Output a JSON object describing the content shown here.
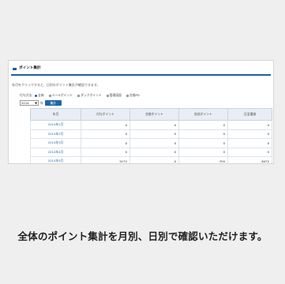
{
  "panel": {
    "title": "ポイント集計",
    "description": "年月をクリックすると、日別のポイント集計が確認できます。",
    "filter": {
      "label": "付与方法：",
      "options": [
        "全体",
        "メールポイント",
        "ダックポイント",
        "管理画面",
        "交換PD"
      ],
      "selected_index": 0
    },
    "year": {
      "value": "2014",
      "arrow": "▼",
      "suffix": "年",
      "button_label": "集計"
    }
  },
  "table": {
    "headers": [
      "年月",
      "付与ポイント",
      "交換ポイント",
      "失効ポイント",
      "日没増減"
    ],
    "rows": [
      {
        "month": "2014年1月",
        "grant": "0",
        "exchange": "0",
        "expire": "0",
        "net": "0"
      },
      {
        "month": "2014年2月",
        "grant": "0",
        "exchange": "0",
        "expire": "0",
        "net": "0"
      },
      {
        "month": "2014年3月",
        "grant": "0",
        "exchange": "0",
        "expire": "0",
        "net": "0"
      },
      {
        "month": "2014年4月",
        "grant": "0",
        "exchange": "0",
        "expire": "0",
        "net": "0"
      },
      {
        "month": "2014年5月",
        "grant": "9172",
        "exchange": "0",
        "expire": "-700",
        "net": "8472"
      }
    ]
  },
  "caption": "全体のポイント集計を月別、日別で確認いただけます。",
  "colors": {
    "accent": "#1f5f9e",
    "button": "#2066a8",
    "link": "#2266aa",
    "header_bg": "#e9eef4"
  }
}
